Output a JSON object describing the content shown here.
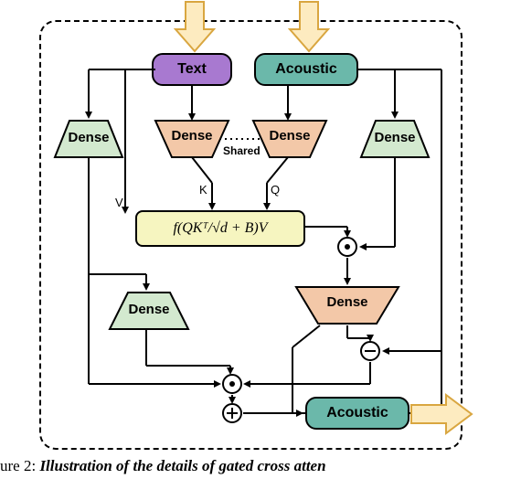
{
  "inputs": {
    "text_label": "Text",
    "acoustic_label": "Acoustic"
  },
  "dense": {
    "label": "Dense",
    "shared_label": "Shared"
  },
  "attention": {
    "k_label": "K",
    "q_label": "Q",
    "v_label": "V",
    "formula": "f(QKᵀ/√d + B)V"
  },
  "output": {
    "acoustic_label": "Acoustic"
  },
  "caption": {
    "prefix": "ure 2:",
    "body": "Illustration of the details of gated cross atten"
  },
  "colors": {
    "text_bg": "#a879d0",
    "acoustic_bg": "#6bb8aa",
    "dense_green": "#d3e9cf",
    "dense_orange": "#f3c8a8",
    "formula_bg": "#f6f5c0",
    "arrow_fill": "#fdebc0",
    "arrow_stroke": "#d9a640"
  }
}
